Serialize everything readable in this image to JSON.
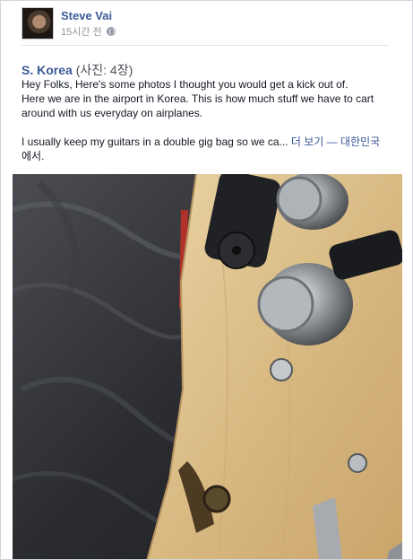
{
  "post": {
    "author": "Steve Vai",
    "timestamp": "15시간 전",
    "privacy_icon": "globe-icon",
    "album_name": "S. Korea",
    "photo_count": "(사진: 4장)",
    "text_line1": "Hey Folks, Here's some photos I thought you would get a kick out of.",
    "text_line2": "Here we are in the airport in Korea. This is how much stuff we have to cart",
    "text_line3": "around with us everyday on airplanes.",
    "text_line4": "I usually keep my guitars in a double gig bag so we ca...",
    "see_more": "더 보기",
    "dash": "—",
    "location_country": "대한민국",
    "location_suffix": "에서."
  },
  "colors": {
    "link": "#3b5998",
    "text": "#141823",
    "meta": "#90949c"
  }
}
